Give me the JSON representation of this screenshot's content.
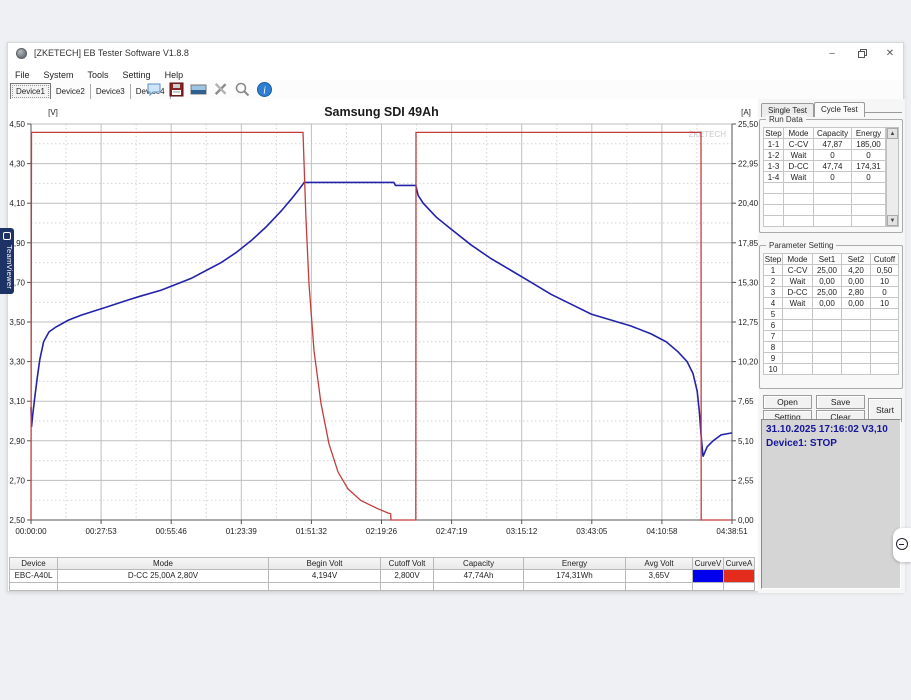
{
  "window": {
    "title": "[ZKETECH] EB Tester Software V1.8.8",
    "controls": {
      "minimize": "minimize",
      "maximize": "maximize",
      "close": "close"
    }
  },
  "menu": {
    "items": [
      "File",
      "System",
      "Tools",
      "Setting",
      "Help"
    ]
  },
  "device_tabs": {
    "items": [
      "Device1",
      "Device2",
      "Device3",
      "Device4"
    ],
    "active": "Device1"
  },
  "toolbar_icons": [
    "open-icon",
    "save-icon",
    "image-export-icon",
    "tools-icon",
    "zoom-icon",
    "info-icon"
  ],
  "chart_data": {
    "type": "line",
    "title": "Samsung SDI 49Ah",
    "watermark": "ZKETECH",
    "grid": true,
    "x_axis": {
      "total_seconds": 16731,
      "tick_labels": [
        "00:00:00",
        "00:27:53",
        "00:55:46",
        "01:23:39",
        "01:51:32",
        "02:19:26",
        "02:47:19",
        "03:15:12",
        "03:43:05",
        "04:10:58",
        "04:38:51"
      ]
    },
    "y_left": {
      "unit": "[V]",
      "min": 2.5,
      "max": 4.5,
      "tick_labels": [
        "4,50",
        "4,30",
        "4,10",
        "3,90",
        "3,70",
        "3,50",
        "3,30",
        "3,10",
        "2,90",
        "2,70",
        "2,50"
      ]
    },
    "y_right": {
      "unit": "[A]",
      "min": 0,
      "max": 25.5,
      "tick_labels": [
        "25,50",
        "22,95",
        "20,40",
        "17,85",
        "15,30",
        "12,75",
        "10,20",
        "7,65",
        "5,10",
        "2,55",
        "0,00"
      ]
    },
    "series": [
      {
        "name": "CurveV",
        "axis": "left",
        "color": "#2323aa",
        "points": [
          [
            0,
            3.07
          ],
          [
            12,
            2.97
          ],
          [
            40,
            3.03
          ],
          [
            90,
            3.12
          ],
          [
            150,
            3.22
          ],
          [
            210,
            3.31
          ],
          [
            300,
            3.4
          ],
          [
            430,
            3.45
          ],
          [
            600,
            3.475
          ],
          [
            900,
            3.51
          ],
          [
            1200,
            3.535
          ],
          [
            1500,
            3.555
          ],
          [
            1800,
            3.575
          ],
          [
            2150,
            3.6
          ],
          [
            2600,
            3.63
          ],
          [
            3100,
            3.66
          ],
          [
            3460,
            3.69
          ],
          [
            3820,
            3.72
          ],
          [
            4180,
            3.76
          ],
          [
            4540,
            3.8
          ],
          [
            4890,
            3.85
          ],
          [
            5250,
            3.91
          ],
          [
            5610,
            3.98
          ],
          [
            5970,
            4.06
          ],
          [
            6210,
            4.12
          ],
          [
            6400,
            4.17
          ],
          [
            6520,
            4.205
          ],
          [
            8660,
            4.205
          ],
          [
            8700,
            4.19
          ],
          [
            9185,
            4.19
          ],
          [
            9240,
            4.14
          ],
          [
            9360,
            4.1
          ],
          [
            9670,
            4.03
          ],
          [
            10020,
            3.97
          ],
          [
            10500,
            3.89
          ],
          [
            10980,
            3.82
          ],
          [
            11460,
            3.76
          ],
          [
            11940,
            3.7
          ],
          [
            12410,
            3.64
          ],
          [
            12890,
            3.59
          ],
          [
            13370,
            3.54
          ],
          [
            13840,
            3.51
          ],
          [
            14320,
            3.48
          ],
          [
            14800,
            3.44
          ],
          [
            15160,
            3.4
          ],
          [
            15440,
            3.35
          ],
          [
            15660,
            3.3
          ],
          [
            15800,
            3.24
          ],
          [
            15900,
            3.15
          ],
          [
            15950,
            3.05
          ],
          [
            15995,
            2.92
          ],
          [
            16040,
            2.82
          ],
          [
            16140,
            2.87
          ],
          [
            16280,
            2.9
          ],
          [
            16470,
            2.93
          ],
          [
            16731,
            2.94
          ]
        ]
      },
      {
        "name": "CurveA",
        "axis": "right",
        "color": "#c43c3c",
        "points": [
          [
            0,
            0
          ],
          [
            12,
            24.96
          ],
          [
            6492,
            24.96
          ],
          [
            6560,
            19.5
          ],
          [
            6635,
            15.2
          ],
          [
            6754,
            10.9
          ],
          [
            6921,
            7.5
          ],
          [
            7112,
            4.9
          ],
          [
            7327,
            3.1
          ],
          [
            7566,
            2.0
          ],
          [
            7876,
            1.25
          ],
          [
            8282,
            0.72
          ],
          [
            8520,
            0.45
          ],
          [
            8585,
            0.4
          ],
          [
            8592,
            0
          ],
          [
            9185,
            0
          ],
          [
            9190,
            24.96
          ],
          [
            15990,
            24.96
          ],
          [
            15995,
            0
          ],
          [
            16731,
            0
          ]
        ]
      }
    ]
  },
  "bottom_table": {
    "headers": [
      "Device",
      "Mode",
      "Begin Volt",
      "Cutoff Volt",
      "Capacity",
      "Energy",
      "Avg Volt",
      "CurveV",
      "CurveA"
    ],
    "row": [
      "EBC-A40L",
      "D-CC  25,00A  2,80V",
      "4,194V",
      "2,800V",
      "47,74Ah",
      "174,31Wh",
      "3,65V",
      "",
      ""
    ],
    "curve_v_color": "#0000ee",
    "curve_a_color": "#e32b1e"
  },
  "right_panel": {
    "tabs": {
      "items": [
        "Single Test",
        "Cycle Test"
      ],
      "active": "Cycle Test"
    },
    "run_data": {
      "label": "Run Data",
      "headers": [
        "Step",
        "Mode",
        "Capacity",
        "Energy"
      ],
      "rows": [
        [
          "1-1",
          "C-CV",
          "47,87",
          "185,00"
        ],
        [
          "1-2",
          "Wait",
          "0",
          "0"
        ],
        [
          "1-3",
          "D-CC",
          "47,74",
          "174,31"
        ],
        [
          "1-4",
          "Wait",
          "0",
          "0"
        ],
        [
          "",
          "",
          "",
          ""
        ],
        [
          "",
          "",
          "",
          ""
        ],
        [
          "",
          "",
          "",
          ""
        ],
        [
          "",
          "",
          "",
          ""
        ]
      ],
      "scrollbar": {
        "up": "▲",
        "down": "▼"
      }
    },
    "parameter_setting": {
      "label": "Parameter Setting",
      "headers": [
        "Step",
        "Mode",
        "Set1",
        "Set2",
        "Cutoff"
      ],
      "rows": [
        [
          "1",
          "C-CV",
          "25,00",
          "4,20",
          "0,50"
        ],
        [
          "2",
          "Wait",
          "0,00",
          "0,00",
          "10"
        ],
        [
          "3",
          "D-CC",
          "25,00",
          "2,80",
          "0"
        ],
        [
          "4",
          "Wait",
          "0,00",
          "0,00",
          "10"
        ],
        [
          "5",
          "",
          "",
          "",
          ""
        ],
        [
          "6",
          "",
          "",
          "",
          ""
        ],
        [
          "7",
          "",
          "",
          "",
          ""
        ],
        [
          "8",
          "",
          "",
          "",
          ""
        ],
        [
          "9",
          "",
          "",
          "",
          ""
        ],
        [
          "10",
          "",
          "",
          "",
          ""
        ]
      ]
    },
    "buttons": {
      "open": "Open",
      "save": "Save",
      "setting": "Setting",
      "clear": "Clear",
      "start": "Start"
    },
    "status": {
      "line1": "31.10.2025 17:16:02  V3,10",
      "line2": "Device1: STOP"
    }
  },
  "teamviewer": {
    "label": "TeamViewer"
  }
}
